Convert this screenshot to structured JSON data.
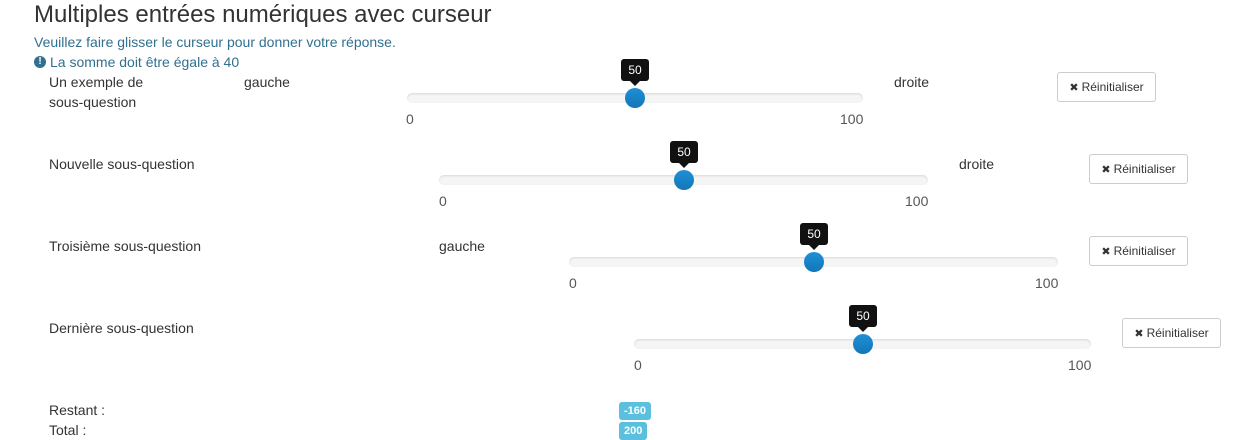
{
  "header": {
    "title": "Multiples entrées numériques avec curseur",
    "instruction": "Veuillez faire glisser le curseur pour donner votre réponse.",
    "note_icon": "exclamation-circle-icon",
    "note": "La somme doit être égale à 40"
  },
  "questions": [
    {
      "label_line1": "Un exemple de",
      "label_line2": "sous-question",
      "left_label": "gauche",
      "right_label": "droite",
      "value": "50",
      "min": "0",
      "max": "100",
      "reset": "Réinitialiser"
    },
    {
      "label_line1": "Nouvelle sous-question",
      "left_label": "",
      "right_label": "droite",
      "value": "50",
      "min": "0",
      "max": "100",
      "reset": "Réinitialiser"
    },
    {
      "label_line1": "Troisième sous-question",
      "left_label": "gauche",
      "right_label": "",
      "value": "50",
      "min": "0",
      "max": "100",
      "reset": "Réinitialiser"
    },
    {
      "label_line1": "Dernière sous-question",
      "left_label": "",
      "right_label": "",
      "value": "50",
      "min": "0",
      "max": "100",
      "reset": "Réinitialiser"
    }
  ],
  "summary": {
    "remaining_label": "Restant :",
    "remaining_value": "-160",
    "total_label": "Total :",
    "total_value": "200"
  },
  "colors": {
    "accent": "#1a85c9",
    "info": "#31708f",
    "badge": "#5bc0de"
  }
}
